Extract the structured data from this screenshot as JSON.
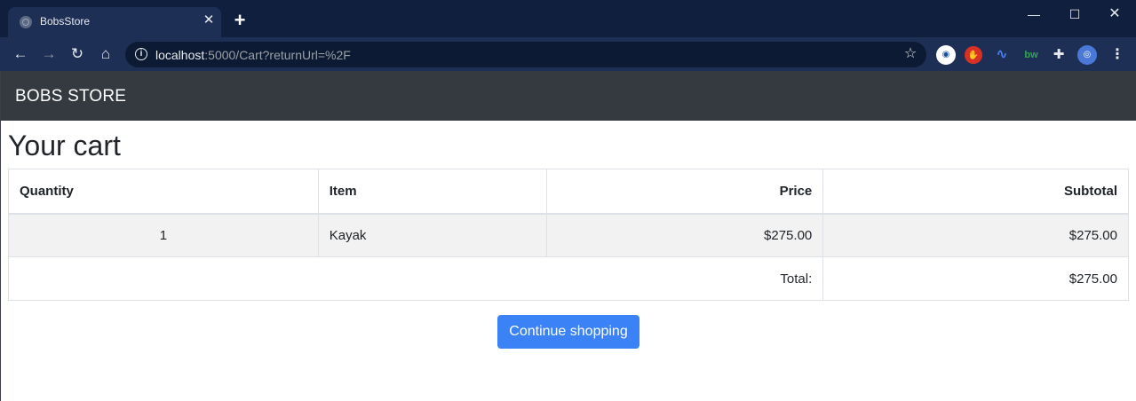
{
  "browser": {
    "tab_title": "BobsStore",
    "tab_close_glyph": "✕",
    "new_tab_glyph": "+",
    "url_host": "localhost",
    "url_rest": ":5000/Cart?returnUrl=%2F",
    "window_controls": {
      "minimize": "—",
      "maximize": "☐",
      "close": "✕"
    },
    "nav": {
      "back": "←",
      "forward": "→",
      "reload": "↻",
      "home": "⌂"
    },
    "info_glyph": "i",
    "star_glyph": "☆",
    "extensions": [
      {
        "name": "ext-face-icon",
        "glyph": "◉"
      },
      {
        "name": "ext-stop-hand-icon",
        "glyph": "✋"
      },
      {
        "name": "ext-waveform-icon",
        "glyph": "∿"
      },
      {
        "name": "ext-bw-icon",
        "glyph": "bw"
      },
      {
        "name": "puzzle-icon",
        "glyph": "✚"
      },
      {
        "name": "profile-avatar-icon",
        "glyph": "◎"
      }
    ],
    "menu_glyph": "⋮"
  },
  "navbar": {
    "brand": "BOBS STORE"
  },
  "main": {
    "title": "Your cart",
    "table": {
      "headers": {
        "quantity": "Quantity",
        "item": "Item",
        "price": "Price",
        "subtotal": "Subtotal"
      },
      "rows": [
        {
          "quantity": "1",
          "item": "Kayak",
          "price": "$275.00",
          "subtotal": "$275.00"
        }
      ],
      "total_label": "Total:",
      "total_value": "$275.00"
    },
    "continue_label": "Continue shopping"
  },
  "colors": {
    "chrome_dark": "#0f1f3d",
    "chrome_tab": "#1e2f55",
    "navbar": "#343a40",
    "primary_button": "#3b82f6",
    "stripe": "#f2f2f2"
  }
}
